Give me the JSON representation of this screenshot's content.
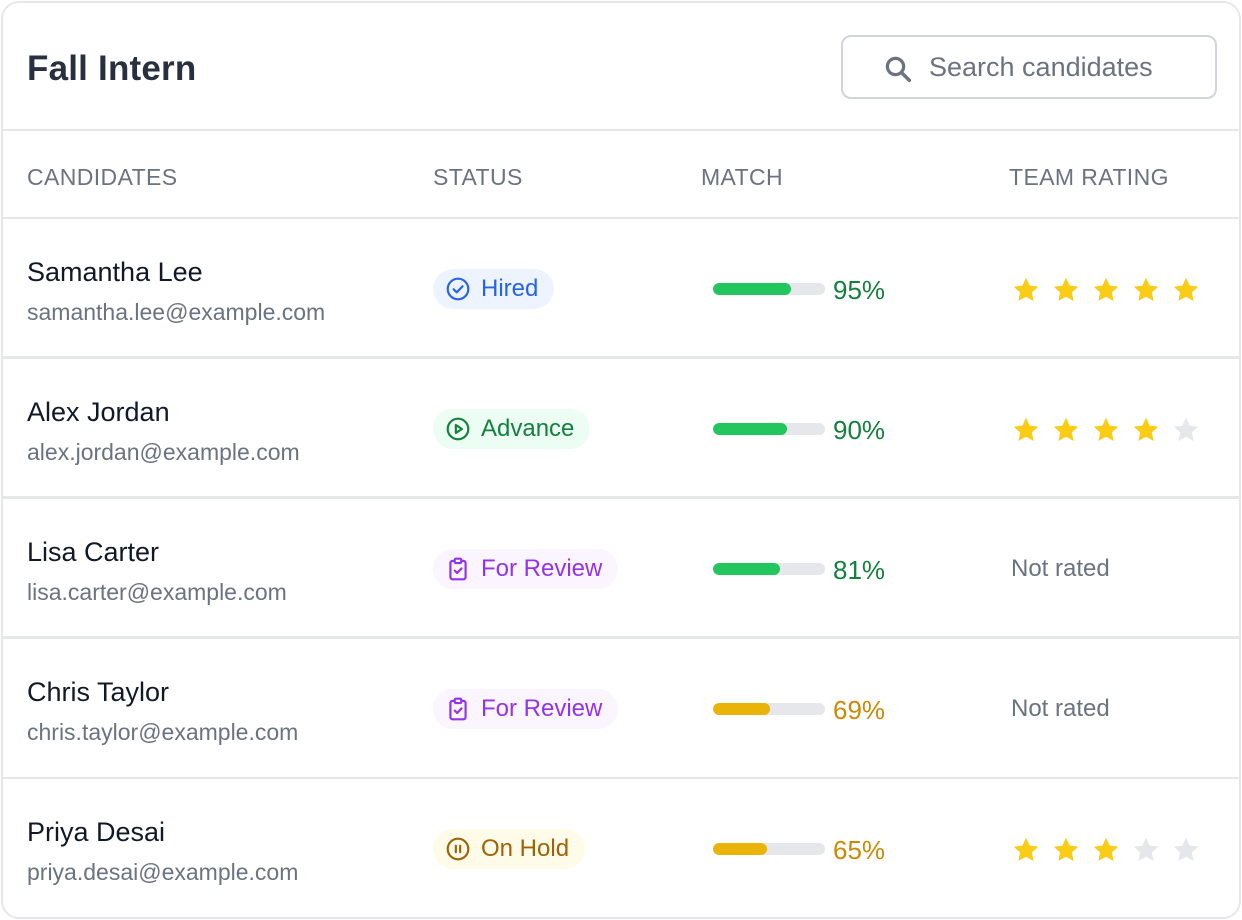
{
  "header": {
    "title": "Fall Intern",
    "search_placeholder": "Search candidates"
  },
  "columns": {
    "candidates": "CANDIDATES",
    "status": "STATUS",
    "match": "MATCH",
    "team_rating": "TEAM RATING"
  },
  "candidates": [
    {
      "name": "Samantha Lee",
      "email": "samantha.lee@example.com",
      "status": "Hired",
      "status_icon": "check-circle-icon",
      "match": "95%",
      "match_value": 95,
      "rating": 5,
      "rating_text": null
    },
    {
      "name": "Alex Jordan",
      "email": "alex.jordan@example.com",
      "status": "Advance",
      "status_icon": "play-circle-icon",
      "match": "90%",
      "match_value": 90,
      "rating": 4,
      "rating_text": null
    },
    {
      "name": "Lisa Carter",
      "email": "lisa.carter@example.com",
      "status": "For Review",
      "status_icon": "clipboard-check-icon",
      "match": "81%",
      "match_value": 81,
      "rating": 0,
      "rating_text": "Not rated"
    },
    {
      "name": "Chris Taylor",
      "email": "chris.taylor@example.com",
      "status": "For Review",
      "status_icon": "clipboard-check-icon",
      "match": "69%",
      "match_value": 69,
      "rating": 0,
      "rating_text": "Not rated"
    },
    {
      "name": "Priya Desai",
      "email": "priya.desai@example.com",
      "status": "On Hold",
      "status_icon": "pause-circle-icon",
      "match": "65%",
      "match_value": 65,
      "rating": 3,
      "rating_text": null
    }
  ],
  "colors": {
    "hired_bg": "#eef4ff",
    "hired_fg": "#2563eb",
    "advance_bg": "#ecfdf3",
    "advance_fg": "#15803d",
    "review_bg": "#faf5ff",
    "review_fg": "#9333ea",
    "hold_bg": "#fefce8",
    "hold_fg": "#a16207",
    "match_high_fill": "#22c55e",
    "match_high_text": "#15803d",
    "match_mid_fill": "#eab308",
    "match_mid_text": "#ca8a04",
    "star_on": "#facc15",
    "star_off": "#e5e7eb"
  }
}
